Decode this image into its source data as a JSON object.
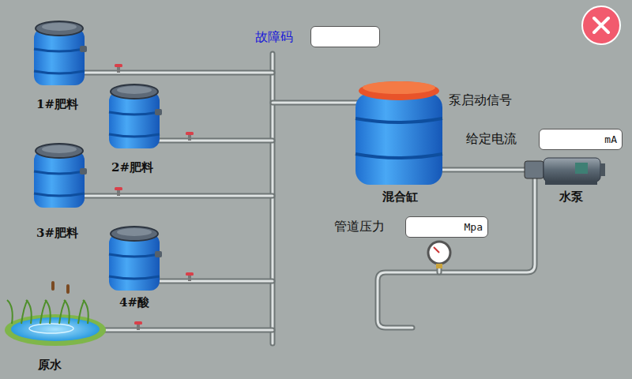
{
  "fault_code": {
    "label": "故障码",
    "value": ""
  },
  "tanks": [
    {
      "label": "1#肥料",
      "kind": "barrel"
    },
    {
      "label": "2#肥料",
      "kind": "barrel"
    },
    {
      "label": "3#肥料",
      "kind": "barrel"
    },
    {
      "label": "4#酸",
      "kind": "barrel"
    },
    {
      "label": "原水",
      "kind": "pond"
    }
  ],
  "mixer": {
    "label": "混合缸"
  },
  "pump": {
    "label": "水泵",
    "start_signal_label": "泵启动信号"
  },
  "current": {
    "label": "给定电流",
    "value": "",
    "unit": "mA"
  },
  "pressure": {
    "label": "管道压力",
    "value": "",
    "unit": "Mpa"
  }
}
